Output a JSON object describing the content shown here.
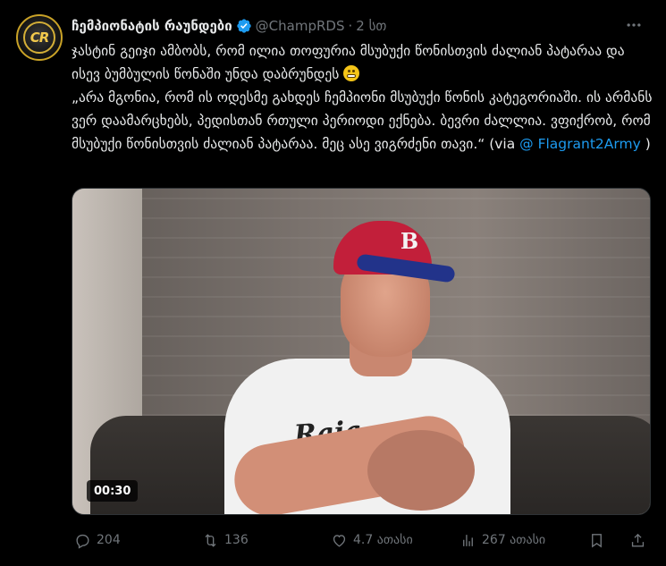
{
  "account": {
    "display_name": "ჩემპიონატის რაუნდები",
    "handle": "@ChampRDS",
    "separator": "·",
    "time": "2 სთ",
    "avatar_text": "CR",
    "verified_color": "#1d9bf0"
  },
  "tweet": {
    "text_part1": "ჯასტინ გეიჯი ამბობს, რომ ილია თოფურია მსუბუქი წონისთვის ძალიან პატარაა და ისევ ბუმბულის წონაში უნდა დაბრუნდეს ",
    "text_part2": "\n„არა მგონია, რომ ის ოდესმე გახდეს ჩემპიონი მსუბუქი წონის კატეგორიაში. ის არმანს ვერ დაამარცხებს, პედისთან რთული პერიოდი ექნება. ბევრი ძალლია. ვფიქრობ, რომ მსუბუქი წონისთვის ძალიან პატარაა. მეც ასე ვიგრძენი თავი.“ (via ",
    "mention": "@ Flagrant2Army",
    "text_part3": " )"
  },
  "media": {
    "duration": "00:30",
    "shirt_text": "Raia",
    "cap_logo": "B"
  },
  "actions": {
    "replies": "204",
    "retweets": "136",
    "likes": "4.7 ათასი",
    "views": "267 ათასი"
  },
  "colors": {
    "background": "#000000",
    "text": "#e7e9ea",
    "muted": "#71767b",
    "link": "#1d9bf0"
  }
}
